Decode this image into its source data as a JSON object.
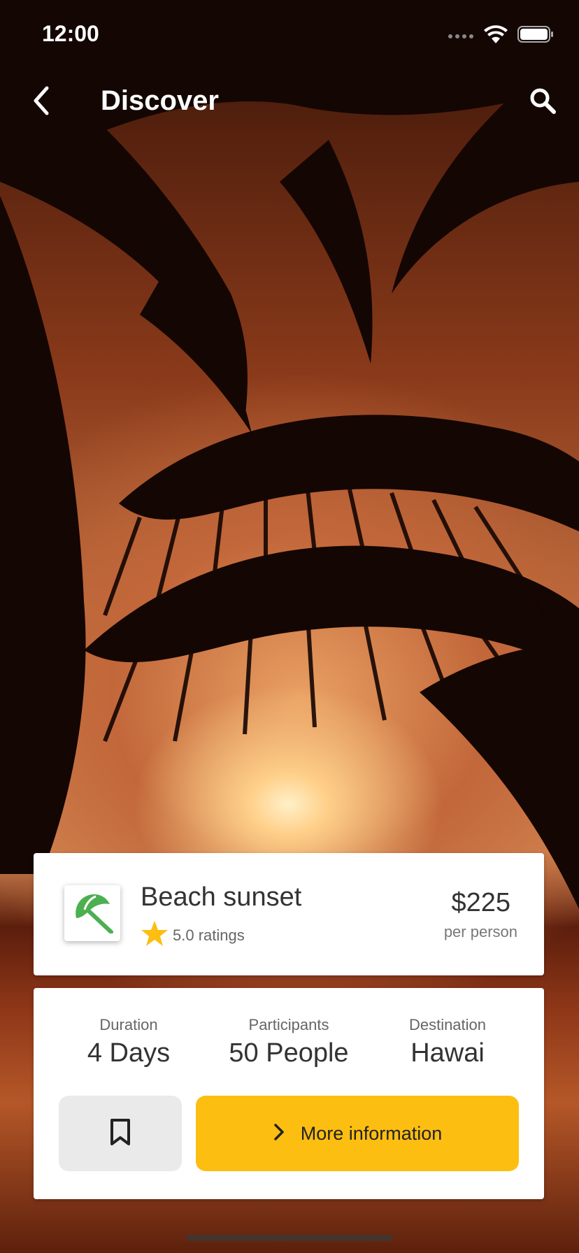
{
  "status_bar": {
    "time": "12:00",
    "icons": [
      "signal-dots-icon",
      "wifi-icon",
      "battery-icon"
    ]
  },
  "app_bar": {
    "title": "Discover",
    "back_icon": "chevron-left-icon",
    "search_icon": "search-icon"
  },
  "trip": {
    "title": "Beach sunset",
    "logo_icon": "beach-umbrella-icon",
    "rating_icon": "star-icon",
    "rating_text": "5.0 ratings",
    "price": "$225",
    "price_unit": "per person"
  },
  "details": {
    "stats": [
      {
        "label": "Duration",
        "value": "4 Days"
      },
      {
        "label": "Participants",
        "value": "50 People"
      },
      {
        "label": "Destination",
        "value": "Hawai"
      }
    ],
    "bookmark_icon": "bookmark-icon",
    "more_button": {
      "icon": "chevron-right-icon",
      "label": "More information"
    }
  },
  "colors": {
    "accent": "#FDBE12",
    "logo_green": "#4CAF50",
    "star": "#FDBE12",
    "bookmark_bg": "#EAEAEA"
  }
}
